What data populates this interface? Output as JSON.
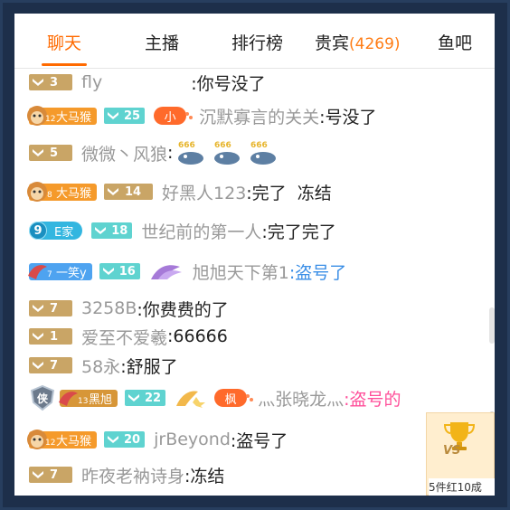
{
  "tabs": [
    {
      "label": "聊天",
      "active": true
    },
    {
      "label": "主播"
    },
    {
      "label": "排行榜"
    },
    {
      "label": "贵宾",
      "count": "(4269)"
    },
    {
      "label": "鱼吧"
    }
  ],
  "colors": {
    "accent": "#ff6a00",
    "gold_badge": "#c9a566",
    "teal_badge": "#5fd3d0",
    "link_blue": "#3a8ee6",
    "pink": "#ff4f9a"
  },
  "messages": [
    {
      "level": "3",
      "nick": "fly",
      "text": ":你号没了"
    },
    {
      "fan_name": "大马猴",
      "fan_level": "12",
      "teal_level": "25",
      "title_badge": "小",
      "nick": "沉默寡言的关关",
      "text": ":号没了"
    },
    {
      "level": "5",
      "nick": "微微丶风狼",
      "text": ":",
      "emote_text": "666"
    },
    {
      "fan_name": "大马猴",
      "fan_level": "8",
      "level": "14",
      "nick": "好黑人123",
      "text": ":完了  冻结"
    },
    {
      "e_num": "9",
      "e_name": "E家",
      "teal_level": "18",
      "nick": "世纪前的第一人",
      "text": ":完了完了"
    },
    {
      "fan_name": "一笑y",
      "fan_level": "7",
      "teal_level": "16",
      "nick": "旭旭天下第1",
      "text": ":盗号了"
    },
    {
      "level": "7",
      "nick": "3258B",
      "text": ":你费费的了"
    },
    {
      "level": "1",
      "nick": "爱至不爱羲",
      "text": ":66666"
    },
    {
      "level": "7",
      "nick": "58永",
      "text": ":舒服了"
    },
    {
      "shield": "侠",
      "fan_name": "黑旭",
      "fan_level": "13",
      "teal_level": "22",
      "title_badge": "枫",
      "nick": "灬张晓龙灬",
      "text": ":盗号的"
    },
    {
      "fan_name": "大马猴",
      "fan_level": "12",
      "teal_level": "20",
      "nick": "jrBeyond",
      "text": ":盗号了"
    },
    {
      "level": "7",
      "nick": "昨夜老衲诗身",
      "text": ":冻结"
    }
  ],
  "ticket": {
    "vs": "VS",
    "label": "5件红10成"
  }
}
